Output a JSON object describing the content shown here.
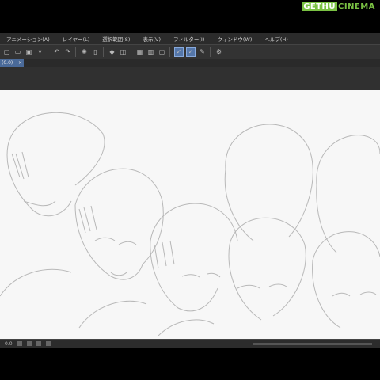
{
  "watermark": {
    "part1": "GETHU",
    "part2": "CINEMA"
  },
  "menu": {
    "items": [
      "アニメーション(A)",
      "レイヤー(L)",
      "選択範囲(S)",
      "表示(V)",
      "フィルター(I)",
      "ウィンドウ(W)",
      "ヘルプ(H)"
    ]
  },
  "tab": {
    "label": "(0.0)",
    "close": "×"
  },
  "status": {
    "zoom": "0.0"
  },
  "icons": {
    "toolbar": [
      "new-file-icon",
      "open-folder-icon",
      "save-icon",
      "dropdown-icon",
      "undo-icon",
      "redo-icon",
      "loading-icon",
      "clear-icon",
      "fill-icon",
      "transform-icon",
      "layer-icon",
      "layer-icon",
      "layer-icon",
      "check-icon",
      "check-icon",
      "pen-icon",
      "settings-icon"
    ]
  }
}
